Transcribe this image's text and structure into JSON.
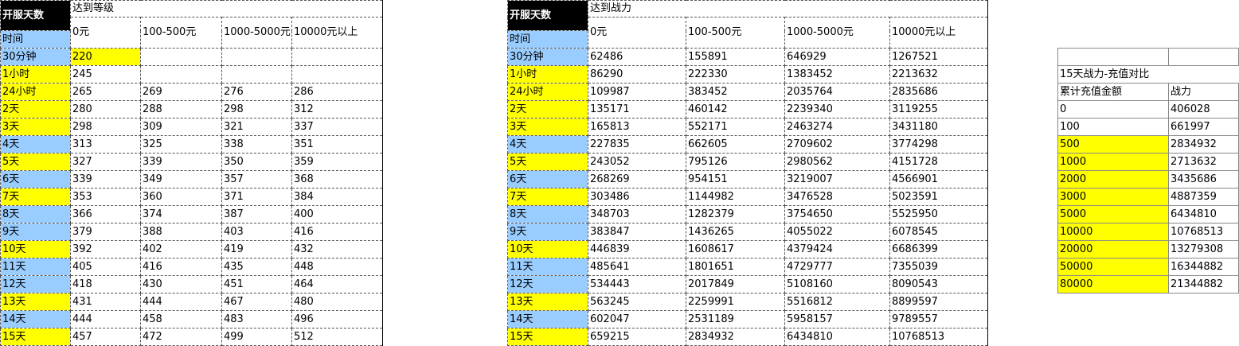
{
  "level_table": {
    "corner": "开服天数",
    "group_title": "达到等级",
    "time_label": "时间",
    "cols": [
      "0元",
      "100-500元",
      "1000-5000元",
      "10000元以上"
    ],
    "rows": [
      {
        "label": "30分钟",
        "color": "blue",
        "cells": [
          "220",
          "",
          "",
          ""
        ],
        "first_yellow": true
      },
      {
        "label": "1小时",
        "color": "yellow",
        "cells": [
          "245",
          "",
          "",
          ""
        ]
      },
      {
        "label": "24小时",
        "color": "yellow",
        "cells": [
          "265",
          "269",
          "276",
          "286"
        ]
      },
      {
        "label": "2天",
        "color": "yellow",
        "cells": [
          "280",
          "288",
          "298",
          "312"
        ]
      },
      {
        "label": "3天",
        "color": "yellow",
        "cells": [
          "298",
          "309",
          "321",
          "337"
        ]
      },
      {
        "label": "4天",
        "color": "blue",
        "cells": [
          "313",
          "325",
          "338",
          "351"
        ]
      },
      {
        "label": "5天",
        "color": "yellow",
        "cells": [
          "327",
          "339",
          "350",
          "359"
        ]
      },
      {
        "label": "6天",
        "color": "blue",
        "cells": [
          "339",
          "349",
          "357",
          "368"
        ]
      },
      {
        "label": "7天",
        "color": "yellow",
        "cells": [
          "353",
          "360",
          "371",
          "384"
        ]
      },
      {
        "label": "8天",
        "color": "blue",
        "cells": [
          "366",
          "374",
          "387",
          "400"
        ]
      },
      {
        "label": "9天",
        "color": "blue",
        "cells": [
          "379",
          "388",
          "403",
          "416"
        ]
      },
      {
        "label": "10天",
        "color": "yellow",
        "cells": [
          "392",
          "402",
          "419",
          "432"
        ]
      },
      {
        "label": "11天",
        "color": "blue",
        "cells": [
          "405",
          "416",
          "435",
          "448"
        ]
      },
      {
        "label": "12天",
        "color": "blue",
        "cells": [
          "418",
          "430",
          "451",
          "464"
        ]
      },
      {
        "label": "13天",
        "color": "yellow",
        "cells": [
          "431",
          "444",
          "467",
          "480"
        ]
      },
      {
        "label": "14天",
        "color": "blue",
        "cells": [
          "444",
          "458",
          "483",
          "496"
        ]
      },
      {
        "label": "15天",
        "color": "yellow",
        "cells": [
          "457",
          "472",
          "499",
          "512"
        ]
      }
    ]
  },
  "power_table": {
    "corner": "开服天数",
    "group_title": "达到战力",
    "time_label": "时间",
    "cols": [
      "0元",
      "100-500元",
      "1000-5000元",
      "10000元以上"
    ],
    "rows": [
      {
        "label": "30分钟",
        "color": "blue",
        "cells": [
          "62486",
          "155891",
          "646929",
          "1267521"
        ]
      },
      {
        "label": "1小时",
        "color": "yellow",
        "cells": [
          "86290",
          "222330",
          "1383452",
          "2213632"
        ]
      },
      {
        "label": "24小时",
        "color": "yellow",
        "cells": [
          "109987",
          "383452",
          "2035764",
          "2835686"
        ]
      },
      {
        "label": "2天",
        "color": "yellow",
        "cells": [
          "135171",
          "460142",
          "2239340",
          "3119255"
        ]
      },
      {
        "label": "3天",
        "color": "yellow",
        "cells": [
          "165813",
          "552171",
          "2463274",
          "3431180"
        ]
      },
      {
        "label": "4天",
        "color": "blue",
        "cells": [
          "227835",
          "662605",
          "2709602",
          "3774298"
        ]
      },
      {
        "label": "5天",
        "color": "yellow",
        "cells": [
          "243052",
          "795126",
          "2980562",
          "4151728"
        ]
      },
      {
        "label": "6天",
        "color": "blue",
        "cells": [
          "268269",
          "954151",
          "3219007",
          "4566901"
        ]
      },
      {
        "label": "7天",
        "color": "yellow",
        "cells": [
          "303486",
          "1144982",
          "3476528",
          "5023591"
        ]
      },
      {
        "label": "8天",
        "color": "blue",
        "cells": [
          "348703",
          "1282379",
          "3754650",
          "5525950"
        ]
      },
      {
        "label": "9天",
        "color": "blue",
        "cells": [
          "383847",
          "1436265",
          "4055022",
          "6078545"
        ]
      },
      {
        "label": "10天",
        "color": "yellow",
        "cells": [
          "446839",
          "1608617",
          "4379424",
          "6686399"
        ]
      },
      {
        "label": "11天",
        "color": "blue",
        "cells": [
          "485641",
          "1801651",
          "4729777",
          "7355039"
        ]
      },
      {
        "label": "12天",
        "color": "blue",
        "cells": [
          "534443",
          "2017849",
          "5108160",
          "8090543"
        ]
      },
      {
        "label": "13天",
        "color": "yellow",
        "cells": [
          "563245",
          "2259991",
          "5516812",
          "8899597"
        ]
      },
      {
        "label": "14天",
        "color": "blue",
        "cells": [
          "602047",
          "2531189",
          "5958157",
          "9789557"
        ]
      },
      {
        "label": "15天",
        "color": "yellow",
        "cells": [
          "659215",
          "2834932",
          "6434810",
          "10768513"
        ]
      }
    ]
  },
  "compare_table": {
    "title": "15天战力-充值对比",
    "col_amount": "累计充值金额",
    "col_power": "战力",
    "rows": [
      {
        "amount": "0",
        "power": "406028",
        "color": "none"
      },
      {
        "amount": "100",
        "power": "661997",
        "color": "none"
      },
      {
        "amount": "500",
        "power": "2834932",
        "color": "yellow"
      },
      {
        "amount": "1000",
        "power": "2713632",
        "color": "yellow"
      },
      {
        "amount": "2000",
        "power": "3435686",
        "color": "yellow"
      },
      {
        "amount": "3000",
        "power": "4887359",
        "color": "yellow"
      },
      {
        "amount": "5000",
        "power": "6434810",
        "color": "yellow"
      },
      {
        "amount": "10000",
        "power": "10768513",
        "color": "yellow"
      },
      {
        "amount": "20000",
        "power": "13279308",
        "color": "yellow"
      },
      {
        "amount": "50000",
        "power": "16344882",
        "color": "yellow"
      },
      {
        "amount": "80000",
        "power": "21344882",
        "color": "yellow"
      }
    ]
  },
  "colors": {
    "blue": "#99ccff",
    "yellow": "#ffff00",
    "header_black": "#000000"
  }
}
